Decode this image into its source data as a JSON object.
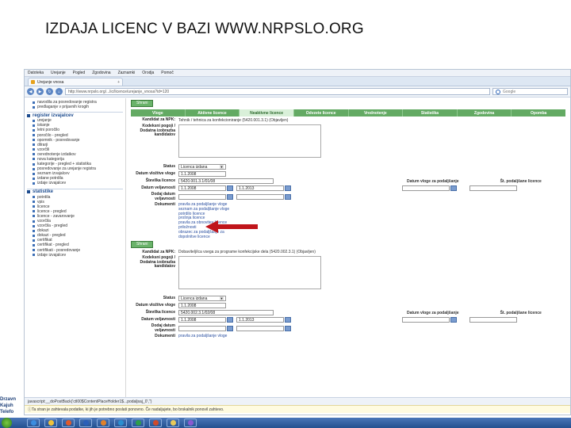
{
  "slide": {
    "title": "IZDAJA LICENC V BAZI WWW.NRPSLO.ORG"
  },
  "browser": {
    "menu": [
      "Datoteka",
      "Urejanje",
      "Pogled",
      "Zgodovina",
      "Zaznamki",
      "Orodja",
      "Pomoč"
    ],
    "tab_title": "Urejanje vnosa",
    "new_tab": "+",
    "url": "http://www.nrpslo.org/...lic/licence/urejanje_vnosa?id=120",
    "search_placeholder": "Google"
  },
  "sidebar": {
    "top_items": [
      "navodila za posredovanje registra",
      "predlaganje v prijavnih krogih"
    ],
    "section1_title": "register izvajalcev",
    "section1_items": [
      "urejanje",
      "iskanje",
      "letni poročilo",
      "poročilo - pregled",
      "opomnik - posredovanje",
      "dilrarji",
      "vzorčili",
      "ovrednotenje izdatkov",
      "nova kategorija",
      "kategorije - pregled + statistika",
      "posredovanje za urejanje registra",
      "seznam izvajalcev",
      "izdane potrdila",
      "izdaje izvajalcev"
    ],
    "section2_title": "statistike",
    "section2_items": [
      "potrdila",
      "vpis",
      "licence",
      "licence - pregled",
      "licence - zavarovanje",
      "vzorčila",
      "vzorčila - pregled",
      "dokazi",
      "dokazi - pregled",
      "certifikat",
      "certifikat - pregled",
      "certifikati - posredovanje",
      "izdaje izvajalcev"
    ]
  },
  "main": {
    "top_button": "Shrani",
    "tabs": [
      "Vloge",
      "Aktivne licence",
      "Neaktivne licence",
      "Odvzete licence",
      "Vrednotenje",
      "Statistika",
      "Zgodovina",
      "Opomba"
    ],
    "active_tab_index": 2,
    "record1": {
      "kandidat_label": "Kandidat za NPK:",
      "kandidat_value": "Tehnik / tehnica za konfekcioniranje (5420.001.3.1) (Objavljen)",
      "kodeks_label": "Kodeksni pogoji / Dodatna izobrazba kandidatov",
      "status_label": "Status",
      "status_value": "Licenca izdana",
      "datum_vlozitve_label": "Datum vložitve vloge",
      "datum_vlozitve_value": "1.1.2008",
      "stevilka_label": "Številka licence",
      "stevilka_value": "5420.001.3.1/01/08",
      "datum_veljavnosti_label": "Datum veljavnosti",
      "datum_veljavnosti_from": "1.1.2008",
      "datum_veljavnosti_to": "1.1.2013",
      "dodaj_label": "Dodaj datum veljavnosti",
      "right_label1": "Datum vloge za podaljšanje",
      "right_label2": "Št. podaljšane licence",
      "dokumenti_label": "Dokumenti",
      "dokumenti": [
        "pravila za podaljšanje vloge",
        "seznam za podaljšanje vloge",
        "potrdilo licence",
        "prošnja licence",
        "pravila za obnovitev licence",
        "priložnosti",
        "obrazec za podaljšanje za",
        "dopolnitve licence"
      ],
      "save_button": "Shrani"
    },
    "record2": {
      "kandidat_label": "Kandidat za NPK:",
      "kandidat_value": "Dobavitelj/ica vsega za programe konfekcijske dela (5420.002.3.1) (Objavljen)",
      "kodeks_label": "Kodeksni pogoji / Dodatna izobrazba kandidatov",
      "status_label": "Status",
      "status_value": "Licenca izdana",
      "datum_vlozitve_label": "Datum vložitve vloge",
      "datum_vlozitve_value": "1.1.2008",
      "stevilka_label": "Številka licence",
      "stevilka_value": "5420.002.3.1/02/08",
      "datum_veljavnosti_label": "Datum veljavnosti",
      "datum_veljavnosti_from": "1.1.2008",
      "datum_veljavnosti_to": "1.1.2013",
      "dodaj_label": "Dodaj datum veljavnosti",
      "right_label1": "Datum vloge za podaljšanje",
      "right_label2": "Št. podaljšane licence",
      "dokumenti_label": "Dokumenti",
      "dokumenti": [
        "pravila za podaljšanje vloge"
      ]
    }
  },
  "status": {
    "url_text": "javascript:__doPostBack('ctl00$ContentPlaceHolder1$...podaljsaj_0','')",
    "info_text": "Ta stran je zahtevala podatke, ki jih je potrebno poslati ponovno. Če nadaljujete, bo brskalnik ponovil zahtevo."
  },
  "left_logo": [
    "Drzavn",
    "Kajuh",
    "Telefo"
  ],
  "colors": {
    "tab_green": "#63aa63",
    "active_tab": "#d9f0d9",
    "arrow": "#c0151b"
  },
  "icons": {
    "taskbar": [
      "start-icon",
      "ie-icon",
      "explorer-icon",
      "media-icon",
      "word-icon",
      "firefox-icon",
      "outlook-icon",
      "excel-icon",
      "powerpoint-icon",
      "folder-icon",
      "paint-icon"
    ]
  }
}
